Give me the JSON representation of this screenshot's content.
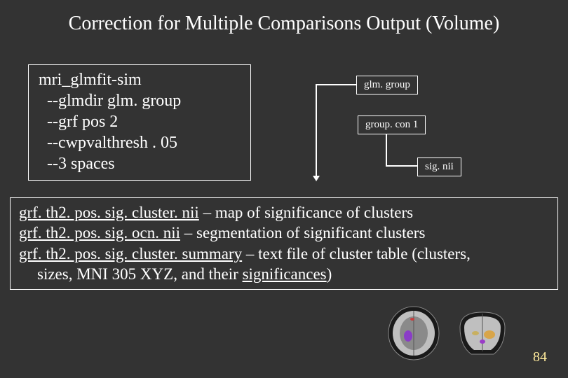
{
  "title": "Correction for Multiple Comparisons Output (Volume)",
  "command": {
    "program": "mri_glmfit-sim",
    "lines": [
      "  --glmdir glm. group",
      "  --grf pos 2",
      "  --cwpvalthresh . 05",
      "  --3 spaces"
    ]
  },
  "diagram": {
    "box1": "glm. group",
    "box2": "group. con 1",
    "box3": "sig. nii"
  },
  "outputs": {
    "line1_file": "grf. th2. pos. sig. cluster. nii",
    "line1_desc": " – map of significance of clusters",
    "line2_file": "grf. th2. pos. sig. ocn. nii",
    "line2_desc": " – segmentation of significant clusters",
    "line3_file": "grf. th2. pos. sig. cluster. summary",
    "line3_desc": " – text file of cluster table (clusters,",
    "line4_cont_a": "sizes, MNI 305 XYZ, and their ",
    "line4_cont_b": "significances",
    "line4_cont_c": ")"
  },
  "page_number": "84"
}
